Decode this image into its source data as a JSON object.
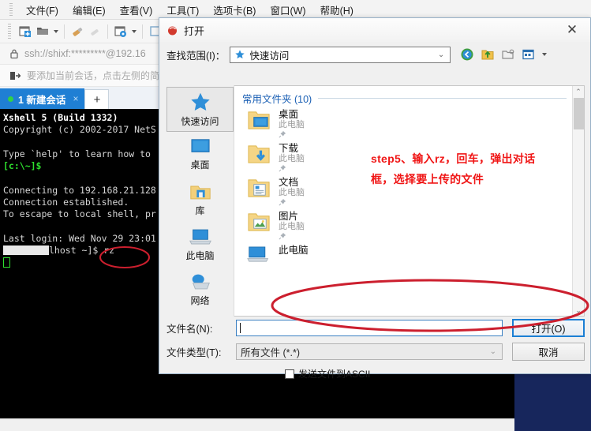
{
  "app": {
    "title": "Xshell 5",
    "menu": [
      {
        "label": "文件(F)"
      },
      {
        "label": "编辑(E)"
      },
      {
        "label": "查看(V)"
      },
      {
        "label": "工具(T)"
      },
      {
        "label": "选项卡(B)"
      },
      {
        "label": "窗口(W)"
      },
      {
        "label": "帮助(H)"
      }
    ],
    "address": "ssh://shixf:*********@192.16",
    "info_bar": "要添加当前会话，点击左侧的简",
    "tab": {
      "label": "1 新建会话",
      "close": "×",
      "add": "+"
    }
  },
  "terminal": {
    "lines": [
      "Xshell 5 (Build 1332)",
      "Copyright (c) 2002-2017 NetS",
      "",
      "Type `help' to learn how to",
      "[c:\\~]$",
      "",
      "Connecting to 192.168.21.128",
      "Connection established.",
      "To escape to local shell, pr",
      "",
      "Last login: Wed Nov 29 23:01"
    ],
    "prompt_tail": "lhost ~]$ rz",
    "header": "Xshell 5 (Build 1332)",
    "copyright": "Copyright (c) 2002-2017 NetS",
    "help_line": "Type `help' to learn how to",
    "local_prompt": "[c:\\~]$",
    "connecting": "Connecting to 192.168.21.128",
    "established": "Connection established.",
    "escape": "To escape to local shell, pr",
    "last_login": "Last login: Wed Nov 29 23:01",
    "command": "rz"
  },
  "dialog": {
    "title": "打开",
    "close_label": "✕",
    "lookin_label": "查找范围(I)：",
    "lookin_value": "快速访问",
    "chevron": "⌄",
    "toolbar": [
      {
        "name": "back-icon",
        "label": "◀"
      },
      {
        "name": "up-folder-icon",
        "label": "↑"
      },
      {
        "name": "new-folder-icon",
        "label": "▱"
      },
      {
        "name": "view-mode-icon",
        "label": "▦"
      }
    ],
    "places": [
      {
        "label": "快速访问",
        "icon": "star-icon",
        "selected": true
      },
      {
        "label": "桌面",
        "icon": "desktop-icon",
        "selected": false
      },
      {
        "label": "库",
        "icon": "library-icon",
        "selected": false
      },
      {
        "label": "此电脑",
        "icon": "this-pc-icon",
        "selected": false
      },
      {
        "label": "网络",
        "icon": "network-icon",
        "selected": false
      }
    ],
    "group_title": "常用文件夹 (10)",
    "group_chevron": "⌃",
    "files": [
      {
        "name": "桌面",
        "sub": "此电脑",
        "pin": "📌",
        "icon": "folder-desktop-icon"
      },
      {
        "name": "下载",
        "sub": "此电脑",
        "pin": "📌",
        "icon": "folder-downloads-icon"
      },
      {
        "name": "文档",
        "sub": "此电脑",
        "pin": "📌",
        "icon": "folder-documents-icon"
      },
      {
        "name": "图片",
        "sub": "此电脑",
        "pin": "📌",
        "icon": "folder-pictures-icon"
      },
      {
        "name": "此电脑",
        "sub": "",
        "pin": "",
        "icon": "this-pc-icon"
      }
    ],
    "filename_label": "文件名(N):",
    "filename_value": "",
    "filetype_label": "文件类型(T):",
    "filetype_value": "所有文件 (*.*)",
    "open_button": "打开(O)",
    "cancel_button": "取消",
    "ascii_label": "发送文件到ASCII",
    "ascii_checked": false,
    "scroll_up": "⌃",
    "scroll_down": "⌄"
  },
  "annotation": {
    "line1": "step5、输入rz，回车，弹出对话",
    "line2": "框，选择要上传的文件",
    "color": "#f01616"
  },
  "colors": {
    "accent": "#1f7fd4",
    "annotation_red": "#f01616",
    "terminal_bg": "#000000",
    "terminal_green": "#2ee02e",
    "right_panel": "#17265c",
    "dialog_bg": "#f0f0f0"
  }
}
